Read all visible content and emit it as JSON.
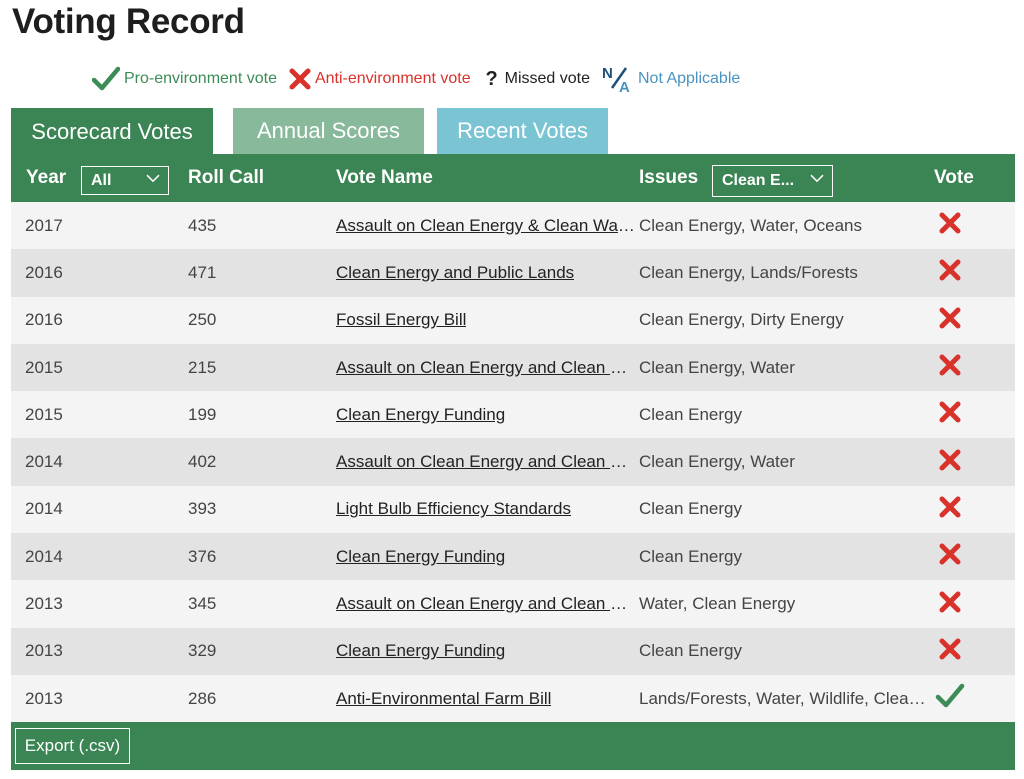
{
  "page": {
    "title": "Voting Record"
  },
  "legend": {
    "pro": "Pro-environment vote",
    "anti": "Anti-environment vote",
    "missed": "Missed vote",
    "na": "Not Applicable"
  },
  "colors": {
    "green": "#3b8454",
    "red": "#d9322b",
    "blue": "#4a93c0",
    "teal": "#7ac4d4"
  },
  "tabs": [
    {
      "label": "Scorecard Votes",
      "active": true
    },
    {
      "label": "Annual Scores",
      "active": false
    },
    {
      "label": "Recent Votes",
      "active": false
    }
  ],
  "table": {
    "headers": {
      "year": "Year",
      "roll_call": "Roll Call",
      "vote_name": "Vote Name",
      "issues": "Issues",
      "vote": "Vote"
    },
    "filters": {
      "year": "All",
      "issues": "Clean E..."
    },
    "rows": [
      {
        "year": "2017",
        "roll_call": "435",
        "vote_name": "Assault on Clean Energy & Clean Water",
        "issues": "Clean Energy, Water, Oceans",
        "vote": "anti"
      },
      {
        "year": "2016",
        "roll_call": "471",
        "vote_name": "Clean Energy and Public Lands",
        "issues": "Clean Energy, Lands/Forests",
        "vote": "anti"
      },
      {
        "year": "2016",
        "roll_call": "250",
        "vote_name": "Fossil Energy Bill",
        "issues": "Clean Energy, Dirty Energy",
        "vote": "anti"
      },
      {
        "year": "2015",
        "roll_call": "215",
        "vote_name": "Assault on Clean Energy and Clean Water",
        "issues": "Clean Energy, Water",
        "vote": "anti"
      },
      {
        "year": "2015",
        "roll_call": "199",
        "vote_name": "Clean Energy Funding",
        "issues": "Clean Energy",
        "vote": "anti"
      },
      {
        "year": "2014",
        "roll_call": "402",
        "vote_name": "Assault on Clean Energy and Clean Water",
        "issues": "Clean Energy, Water",
        "vote": "anti"
      },
      {
        "year": "2014",
        "roll_call": "393",
        "vote_name": "Light Bulb Efficiency Standards",
        "issues": "Clean Energy",
        "vote": "anti"
      },
      {
        "year": "2014",
        "roll_call": "376",
        "vote_name": "Clean Energy Funding",
        "issues": "Clean Energy",
        "vote": "anti"
      },
      {
        "year": "2013",
        "roll_call": "345",
        "vote_name": "Assault on Clean Energy and Clean Water",
        "issues": "Water, Clean Energy",
        "vote": "anti"
      },
      {
        "year": "2013",
        "roll_call": "329",
        "vote_name": "Clean Energy Funding",
        "issues": "Clean Energy",
        "vote": "anti"
      },
      {
        "year": "2013",
        "roll_call": "286",
        "vote_name": "Anti-Environmental Farm Bill",
        "issues": "Lands/Forests, Water, Wildlife, Clean Energy",
        "vote": "pro"
      }
    ]
  },
  "footer": {
    "export_label": "Export (.csv)"
  }
}
